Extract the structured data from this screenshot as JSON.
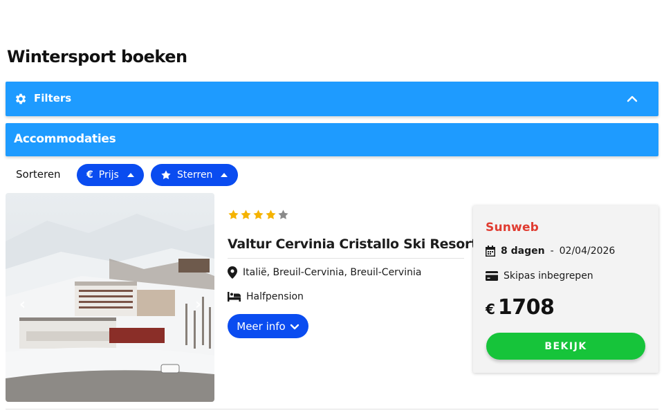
{
  "page": {
    "title": "Wintersport boeken"
  },
  "filters": {
    "label": "Filters",
    "icon": "gear-icon",
    "toggle_icon": "chevron-up-icon"
  },
  "accommodations": {
    "label": "Accommodaties"
  },
  "sort": {
    "label": "Sorteren",
    "buttons": [
      {
        "label": "Prijs",
        "icon": "euro-icon",
        "direction_icon": "caret-up-icon"
      },
      {
        "label": "Sterren",
        "icon": "star-icon",
        "direction_icon": "caret-up-icon"
      }
    ]
  },
  "colors": {
    "accent": "#1e9bff",
    "button_blue": "#0a4cf0",
    "cta_green": "#16c43a",
    "brand_red": "#e03c31",
    "star_gold": "#f5b301"
  },
  "result": {
    "image_arrows": {
      "prev": "‹",
      "next": "›"
    },
    "rating": {
      "stars": 4,
      "max": 5
    },
    "name": "Valtur Cervinia Cristallo Ski Resort",
    "location": "Italië, Breuil-Cervinia, Breuil-Cervinia",
    "board": "Halfpension",
    "more_info_label": "Meer info",
    "offer": {
      "provider": "Sunweb",
      "duration": "8 dagen",
      "separator": "-",
      "date": "02/04/2026",
      "skipass": "Skipas inbegrepen",
      "currency": "€",
      "price": "1708",
      "cta_label": "BEKIJK"
    }
  }
}
